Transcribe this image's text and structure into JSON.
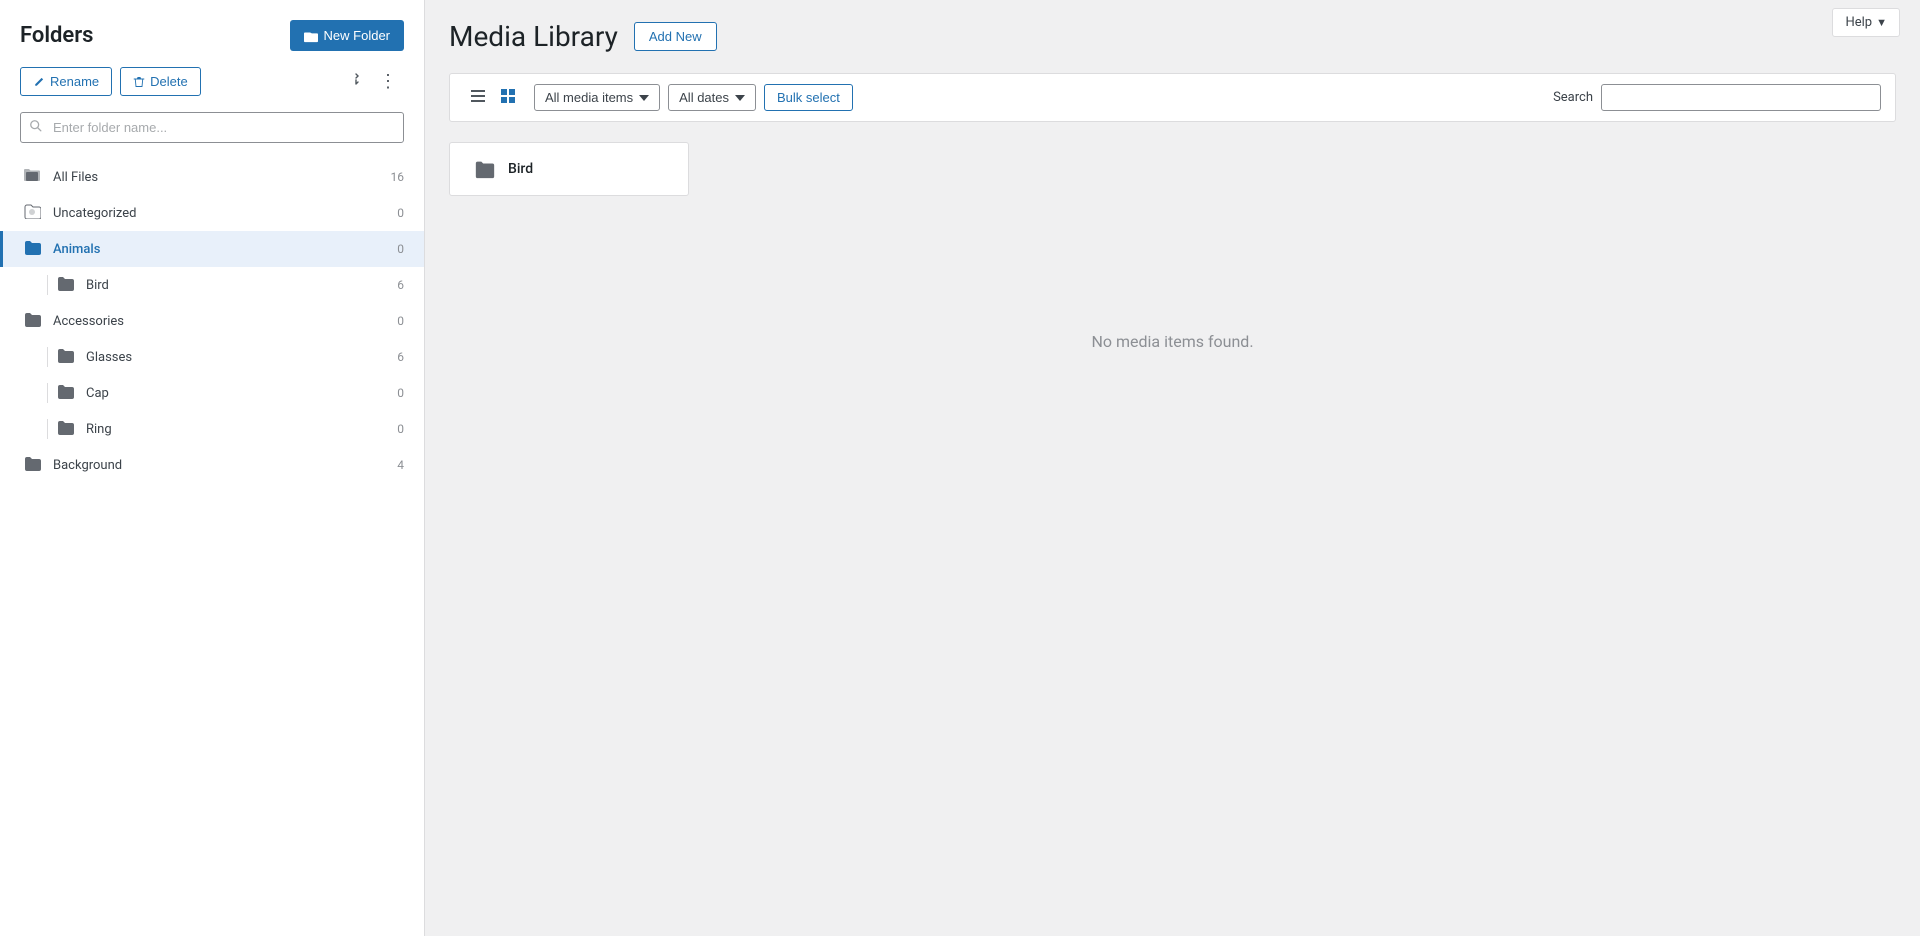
{
  "help": {
    "label": "Help",
    "chevron": "▼"
  },
  "sidebar": {
    "title": "Folders",
    "new_folder_btn": "New Folder",
    "rename_btn": "Rename",
    "delete_btn": "Delete",
    "folder_search_placeholder": "Enter folder name...",
    "folders": [
      {
        "id": "all-files",
        "name": "All Files",
        "count": "16",
        "indent": 0,
        "active": false,
        "has_icon": "all-files"
      },
      {
        "id": "uncategorized",
        "name": "Uncategorized",
        "count": "0",
        "indent": 0,
        "active": false,
        "has_icon": "uncategorized"
      },
      {
        "id": "animals",
        "name": "Animals",
        "count": "0",
        "indent": 0,
        "active": true,
        "has_icon": "folder"
      },
      {
        "id": "bird",
        "name": "Bird",
        "count": "6",
        "indent": 1,
        "active": false,
        "has_icon": "folder"
      },
      {
        "id": "accessories",
        "name": "Accessories",
        "count": "0",
        "indent": 0,
        "active": false,
        "has_icon": "folder"
      },
      {
        "id": "glasses",
        "name": "Glasses",
        "count": "6",
        "indent": 1,
        "active": false,
        "has_icon": "folder"
      },
      {
        "id": "cap",
        "name": "Cap",
        "count": "0",
        "indent": 1,
        "active": false,
        "has_icon": "folder"
      },
      {
        "id": "ring",
        "name": "Ring",
        "count": "0",
        "indent": 1,
        "active": false,
        "has_icon": "folder"
      },
      {
        "id": "background",
        "name": "Background",
        "count": "4",
        "indent": 0,
        "active": false,
        "has_icon": "folder"
      }
    ]
  },
  "main": {
    "title": "Media Library",
    "add_new_btn": "Add New",
    "filter_items": "All media items",
    "filter_dates": "All dates",
    "bulk_select_btn": "Bulk select",
    "search_label": "Search",
    "search_placeholder": "",
    "subfolder_card": "Bird",
    "no_items_text": "No media items found."
  }
}
